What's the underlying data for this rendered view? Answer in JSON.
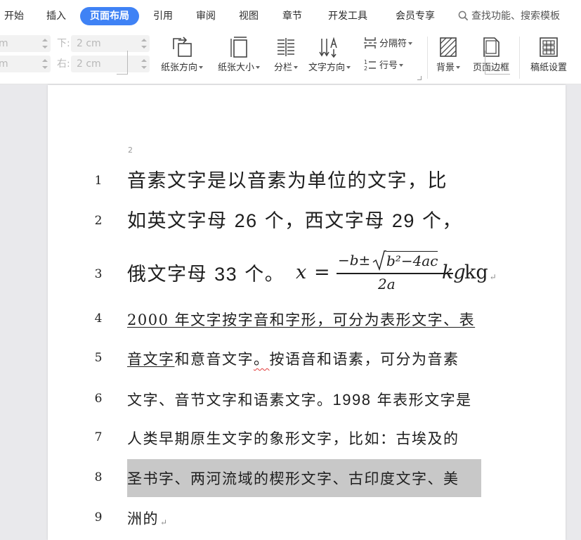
{
  "tabs": [
    {
      "label": "开始"
    },
    {
      "label": "插入"
    },
    {
      "label": "页面布局"
    },
    {
      "label": "引用"
    },
    {
      "label": "审阅"
    },
    {
      "label": "视图"
    },
    {
      "label": "章节"
    },
    {
      "label": "开发工具"
    },
    {
      "label": "会员专享"
    }
  ],
  "active_tab": "页面布局",
  "search": {
    "label": "查找功能、搜索模板",
    "icon": "search-icon"
  },
  "margins": {
    "top_left_value": "m",
    "bottom_left_value": "m",
    "bottom_label": "下:",
    "bottom_value": "2 cm",
    "right_label": "右:",
    "right_value": "2 cm"
  },
  "ribbon": {
    "orientation": "纸张方向",
    "size": "纸张大小",
    "columns": "分栏",
    "text_direction": "文字方向",
    "breaks": "分隔符",
    "line_numbers": "行号",
    "background": "背景",
    "page_border": "页面边框",
    "manuscript": "稿纸设置"
  },
  "doc": {
    "para_mark_top": "2",
    "line_numbers": [
      "1",
      "2",
      "3",
      "4",
      "5",
      "6",
      "7",
      "8",
      "9"
    ],
    "line1": "音素文字是以音素为单位的文字，比",
    "line2_a": "如英文字母 ",
    "line2_num1": "26",
    "line2_b": " 个，西文字母 ",
    "line2_num2": "29",
    "line2_c": " 个，",
    "line3_a": "俄文字母 ",
    "line3_num": "33",
    "line3_b": " 个。",
    "eq_x": "x",
    "eq_equals": "=",
    "eq_numer_left": "−b±",
    "eq_radicand": "b²−4ac",
    "eq_denom": "2a",
    "eq_kg_italic": "kg",
    "eq_kg_roman": "kg",
    "line4": "2000 年文字按字音和字形，可分为表形文字、表",
    "line5_a": "音文字",
    "line5_b": "和意音文字",
    "line5_c": "。",
    "line5_d": "按语音和语素，可分为音素",
    "line6_a": "文字、音节文字和语素文字。",
    "line6_num": "1998",
    "line6_b": " 年表形文字是",
    "line7": "人类早期原生文字的象形文字，比如：古埃及的",
    "line8": "圣书字、两河流域的楔形文字、古印度文字、美",
    "line9": "洲的",
    "return_mark": "↵"
  },
  "colors": {
    "accent": "#3f82f5",
    "highlight": "#c8c8c8",
    "spell_error": "#e23b3b"
  }
}
